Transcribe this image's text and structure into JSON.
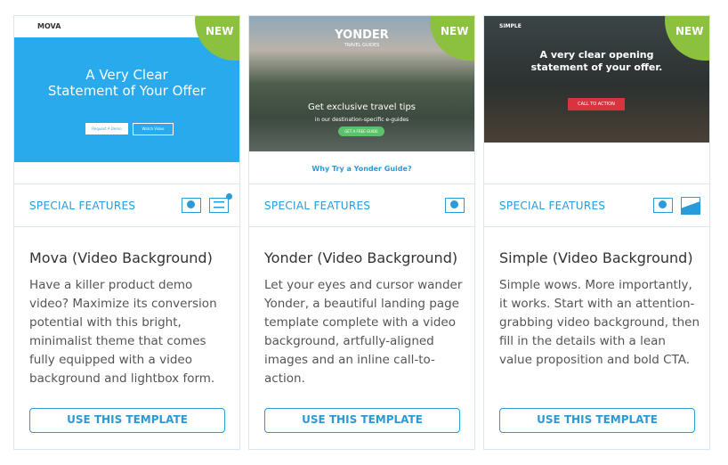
{
  "badge": "NEW",
  "cards": [
    {
      "thumb": {
        "logo": "MOVA",
        "headline1": "A Very Clear",
        "headline2": "Statement of Your Offer",
        "btn1": "Request A Demo",
        "btn2": "Watch Video"
      },
      "features_label": "SPECIAL FEATURES",
      "feature_icons": [
        "video-icon",
        "list-form-icon"
      ],
      "title": "Mova (Video Background)",
      "description": "Have a killer product demo video? Maximize its conversion potential with this bright, minimalist theme that comes fully equipped with a video background and lightbox form.",
      "button": "USE THIS TEMPLATE"
    },
    {
      "thumb": {
        "logo": "YONDER",
        "sublogo": "TRAVEL GUIDES",
        "headline1": "Get exclusive travel tips",
        "headline2": "in our destination-specific e-guides",
        "btn1": "GET A FREE GUIDE",
        "section": "Why Try a Yonder Guide?"
      },
      "features_label": "SPECIAL FEATURES",
      "feature_icons": [
        "video-icon"
      ],
      "title": "Yonder (Video Background)",
      "description": "Let your eyes and cursor wander Yonder, a beautiful landing page template complete with a video background, artfully-aligned images and an inline call-to-action.",
      "button": "USE THIS TEMPLATE"
    },
    {
      "thumb": {
        "logo": "SIMPLE",
        "headline1": "A very clear opening",
        "headline2": "statement of your offer.",
        "btn1": "CALL TO ACTION"
      },
      "features_label": "SPECIAL FEATURES",
      "feature_icons": [
        "video-icon",
        "image-icon"
      ],
      "title": "Simple (Video Background)",
      "description": "Simple wows. More importantly, it works. Start with an attention-grabbing video background, then fill in the details with a lean value proposition and bold CTA.",
      "button": "USE THIS TEMPLATE"
    }
  ],
  "colors": {
    "accent": "#2a9ad8",
    "badge": "#8cc03f",
    "border": "#d9e6ef"
  }
}
